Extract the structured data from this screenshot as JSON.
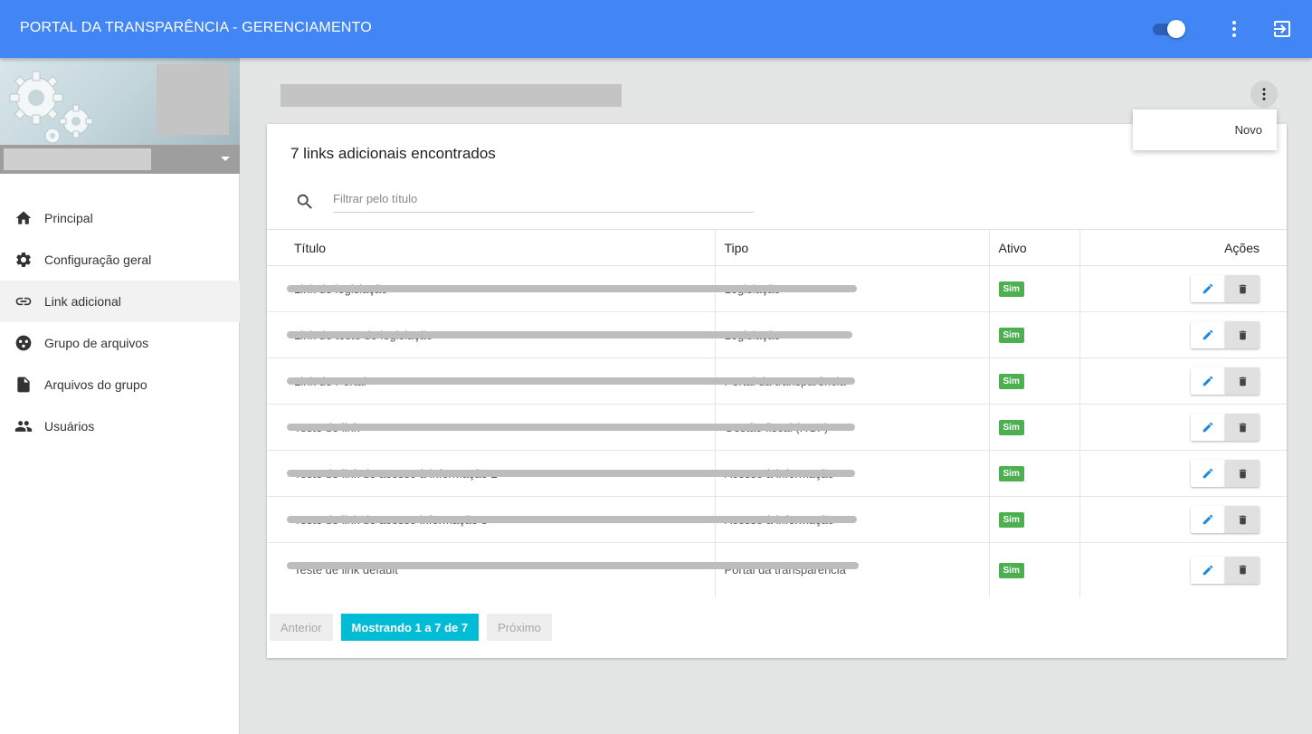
{
  "header": {
    "title": "PORTAL DA TRANSPARÊNCIA - GERENCIAMENTO",
    "toggle_state": "on",
    "icons": [
      "more-vert-icon",
      "exit-icon"
    ]
  },
  "sidebar": {
    "items": [
      {
        "label": "Principal",
        "icon": "home-icon"
      },
      {
        "label": "Configuração geral",
        "icon": "gear-icon"
      },
      {
        "label": "Link adicional",
        "icon": "link-icon",
        "active": true
      },
      {
        "label": "Grupo de arquivos",
        "icon": "group-icon"
      },
      {
        "label": "Arquivos do grupo",
        "icon": "file-icon"
      },
      {
        "label": "Usuários",
        "icon": "users-icon"
      }
    ]
  },
  "page_menu": {
    "items": [
      "Novo"
    ]
  },
  "card": {
    "title": "7 links adicionais encontrados",
    "search_placeholder": "Filtrar pelo título",
    "columns": [
      "Título",
      "Tipo",
      "Ativo",
      "Ações"
    ],
    "rows": [
      {
        "titulo": "Link de legislação",
        "tipo": "Legislação",
        "ativo": "Sim"
      },
      {
        "titulo": "Link de teste de legislação",
        "tipo": "Legislação",
        "ativo": "Sim"
      },
      {
        "titulo": "Link de Portal",
        "tipo": "Portal da transparência",
        "ativo": "Sim"
      },
      {
        "titulo": "Teste de link",
        "tipo": "Gestão fiscal (RGF)",
        "ativo": "Sim"
      },
      {
        "titulo": "Teste de link de acesso à informação 2",
        "tipo": "Acesso à informação",
        "ativo": "Sim"
      },
      {
        "titulo": "Teste de link de acesso informação 3",
        "tipo": "Acesso à informação",
        "ativo": "Sim"
      },
      {
        "titulo": "Teste de link default",
        "tipo": "Portal da transparência",
        "ativo": "Sim"
      }
    ]
  },
  "pager": {
    "prev": "Anterior",
    "info": "Mostrando 1 a 7 de 7",
    "next": "Próximo"
  },
  "colors": {
    "header": "#4285f4",
    "active_badge": "#4caf50",
    "pager_info": "#00bcd4",
    "edit_icon": "#1e88e5"
  }
}
